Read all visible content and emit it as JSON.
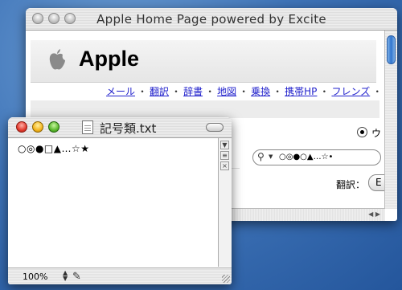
{
  "browser": {
    "title": "Apple Home Page powered by Excite",
    "brand": "Apple",
    "nav": [
      {
        "label": "メール"
      },
      {
        "label": "翻訳"
      },
      {
        "label": "辞書"
      },
      {
        "label": "地図"
      },
      {
        "label": "乗換"
      },
      {
        "label": "携帯HP"
      },
      {
        "label": "フレンズ"
      }
    ],
    "nav_sep": "・",
    "radio_label": "ウ",
    "search_value": "○◎●○▲…☆•",
    "translate_label": "翻訳：",
    "translate_value": "E"
  },
  "textedit": {
    "title": "記号類.txt",
    "content": "○◎●□▲…☆★",
    "zoom": "100%"
  },
  "icons": {
    "apple_logo": "apple-logo-icon",
    "document": "document-icon",
    "pencil": "pencil-icon",
    "magnifier": "search-icon"
  }
}
